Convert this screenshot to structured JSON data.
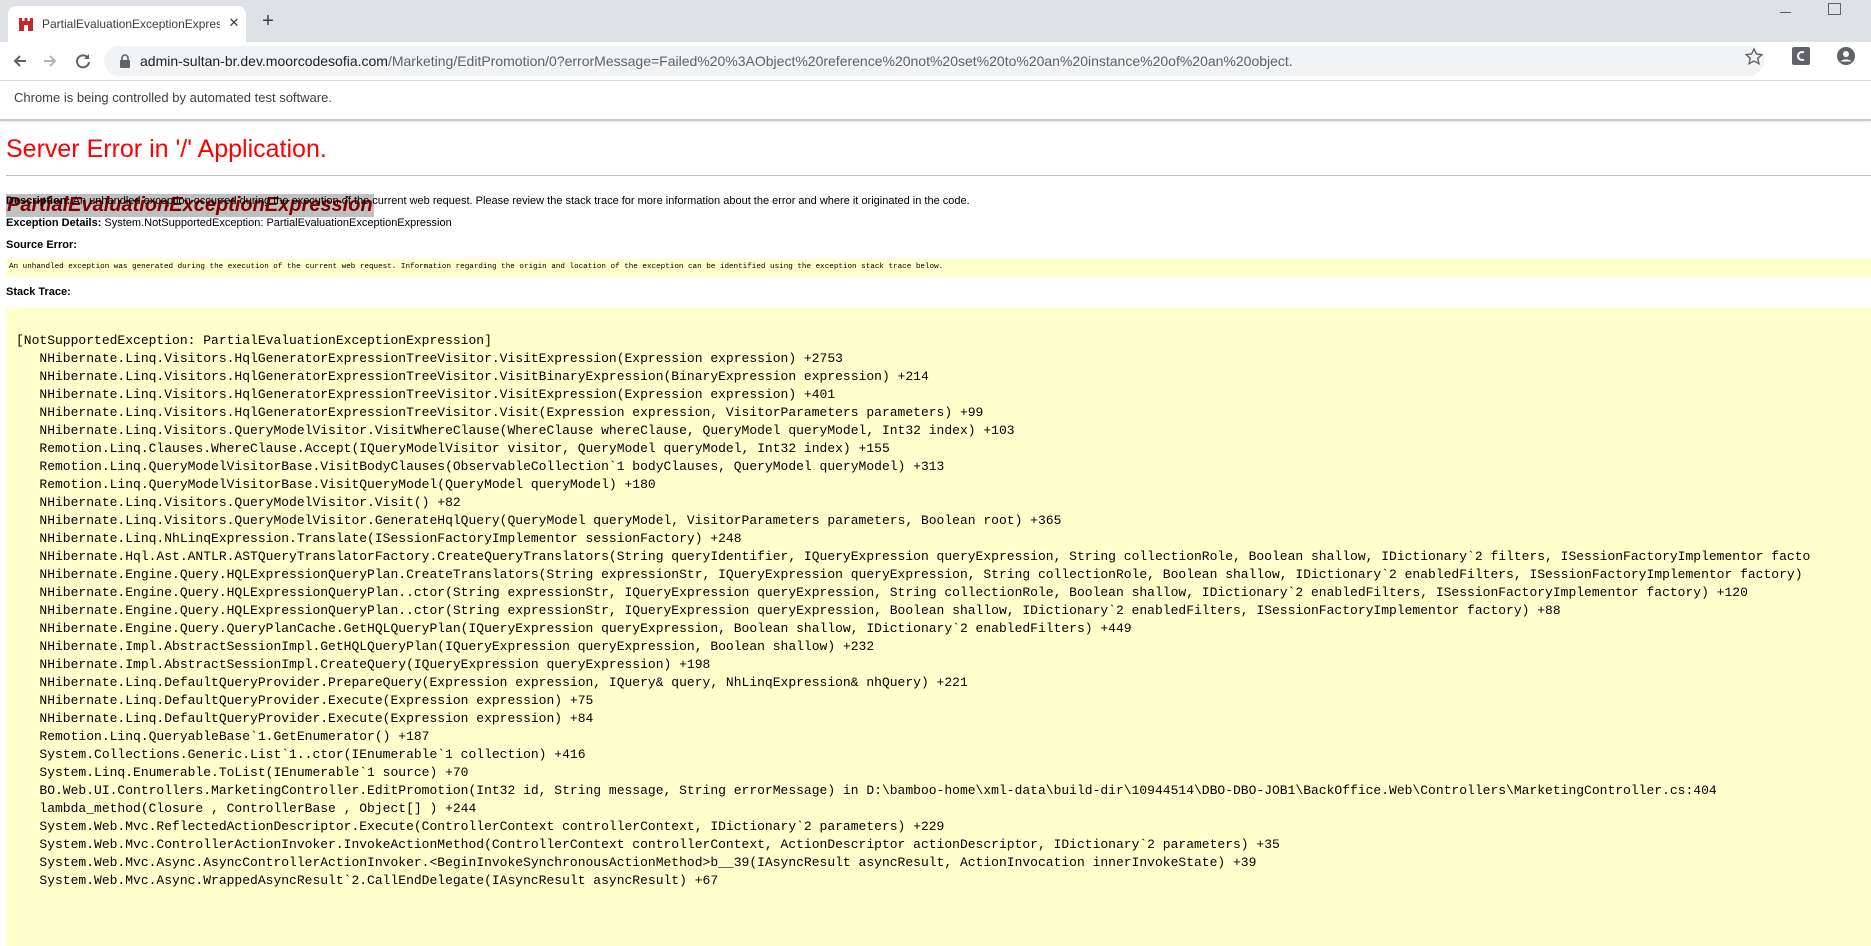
{
  "browser": {
    "tab_title": "PartialEvaluationExceptionExpression",
    "url_host": "admin-sultan-br.dev.moorcodesofia.com",
    "url_path": "/Marketing/EditPromotion/0?errorMessage=Failed%20%3AObject%20reference%20not%20set%20to%20an%20instance%20of%20an%20object.",
    "infobar_text": "Chrome is being controlled by automated test software."
  },
  "page": {
    "heading": "Server Error in '/' Application.",
    "exception_title": "PartialEvaluationExceptionExpression",
    "description_label": "Description:",
    "description_text": "An unhandled exception occurred during the execution of the current web request. Please review the stack trace for more information about the error and where it originated in the code.",
    "exception_details_label": "Exception Details:",
    "exception_details_text": "System.NotSupportedException: PartialEvaluationExceptionExpression",
    "source_error_label": "Source Error:",
    "source_error_text": "An unhandled exception was generated during the execution of the current web request. Information regarding the origin and location of the exception can be identified using the exception stack trace below.",
    "stack_trace_label": "Stack Trace:",
    "stack_trace": [
      "[NotSupportedException: PartialEvaluationExceptionExpression]",
      "   NHibernate.Linq.Visitors.HqlGeneratorExpressionTreeVisitor.VisitExpression(Expression expression) +2753",
      "   NHibernate.Linq.Visitors.HqlGeneratorExpressionTreeVisitor.VisitBinaryExpression(BinaryExpression expression) +214",
      "   NHibernate.Linq.Visitors.HqlGeneratorExpressionTreeVisitor.VisitExpression(Expression expression) +401",
      "   NHibernate.Linq.Visitors.HqlGeneratorExpressionTreeVisitor.Visit(Expression expression, VisitorParameters parameters) +99",
      "   NHibernate.Linq.Visitors.QueryModelVisitor.VisitWhereClause(WhereClause whereClause, QueryModel queryModel, Int32 index) +103",
      "   Remotion.Linq.Clauses.WhereClause.Accept(IQueryModelVisitor visitor, QueryModel queryModel, Int32 index) +155",
      "   Remotion.Linq.QueryModelVisitorBase.VisitBodyClauses(ObservableCollection`1 bodyClauses, QueryModel queryModel) +313",
      "   Remotion.Linq.QueryModelVisitorBase.VisitQueryModel(QueryModel queryModel) +180",
      "   NHibernate.Linq.Visitors.QueryModelVisitor.Visit() +82",
      "   NHibernate.Linq.Visitors.QueryModelVisitor.GenerateHqlQuery(QueryModel queryModel, VisitorParameters parameters, Boolean root) +365",
      "   NHibernate.Linq.NhLinqExpression.Translate(ISessionFactoryImplementor sessionFactory) +248",
      "   NHibernate.Hql.Ast.ANTLR.ASTQueryTranslatorFactory.CreateQueryTranslators(String queryIdentifier, IQueryExpression queryExpression, String collectionRole, Boolean shallow, IDictionary`2 filters, ISessionFactoryImplementor facto",
      "   NHibernate.Engine.Query.HQLExpressionQueryPlan.CreateTranslators(String expressionStr, IQueryExpression queryExpression, String collectionRole, Boolean shallow, IDictionary`2 enabledFilters, ISessionFactoryImplementor factory)",
      "   NHibernate.Engine.Query.HQLExpressionQueryPlan..ctor(String expressionStr, IQueryExpression queryExpression, String collectionRole, Boolean shallow, IDictionary`2 enabledFilters, ISessionFactoryImplementor factory) +120",
      "   NHibernate.Engine.Query.HQLExpressionQueryPlan..ctor(String expressionStr, IQueryExpression queryExpression, Boolean shallow, IDictionary`2 enabledFilters, ISessionFactoryImplementor factory) +88",
      "   NHibernate.Engine.Query.QueryPlanCache.GetHQLQueryPlan(IQueryExpression queryExpression, Boolean shallow, IDictionary`2 enabledFilters) +449",
      "   NHibernate.Impl.AbstractSessionImpl.GetHQLQueryPlan(IQueryExpression queryExpression, Boolean shallow) +232",
      "   NHibernate.Impl.AbstractSessionImpl.CreateQuery(IQueryExpression queryExpression) +198",
      "   NHibernate.Linq.DefaultQueryProvider.PrepareQuery(Expression expression, IQuery& query, NhLinqExpression& nhQuery) +221",
      "   NHibernate.Linq.DefaultQueryProvider.Execute(Expression expression) +75",
      "   NHibernate.Linq.DefaultQueryProvider.Execute(Expression expression) +84",
      "   Remotion.Linq.QueryableBase`1.GetEnumerator() +187",
      "   System.Collections.Generic.List`1..ctor(IEnumerable`1 collection) +416",
      "   System.Linq.Enumerable.ToList(IEnumerable`1 source) +70",
      "   BO.Web.UI.Controllers.MarketingController.EditPromotion(Int32 id, String message, String errorMessage) in D:\\bamboo-home\\xml-data\\build-dir\\10944514\\DBO-DBO-JOB1\\BackOffice.Web\\Controllers\\MarketingController.cs:404",
      "   lambda_method(Closure , ControllerBase , Object[] ) +244",
      "   System.Web.Mvc.ReflectedActionDescriptor.Execute(ControllerContext controllerContext, IDictionary`2 parameters) +229",
      "   System.Web.Mvc.ControllerActionInvoker.InvokeActionMethod(ControllerContext controllerContext, ActionDescriptor actionDescriptor, IDictionary`2 parameters) +35",
      "   System.Web.Mvc.Async.AsyncControllerActionInvoker.<BeginInvokeSynchronousActionMethod>b__39(IAsyncResult asyncResult, ActionInvocation innerInvokeState) +39",
      "   System.Web.Mvc.Async.WrappedAsyncResult`2.CallEndDelegate(IAsyncResult asyncResult) +67"
    ]
  }
}
